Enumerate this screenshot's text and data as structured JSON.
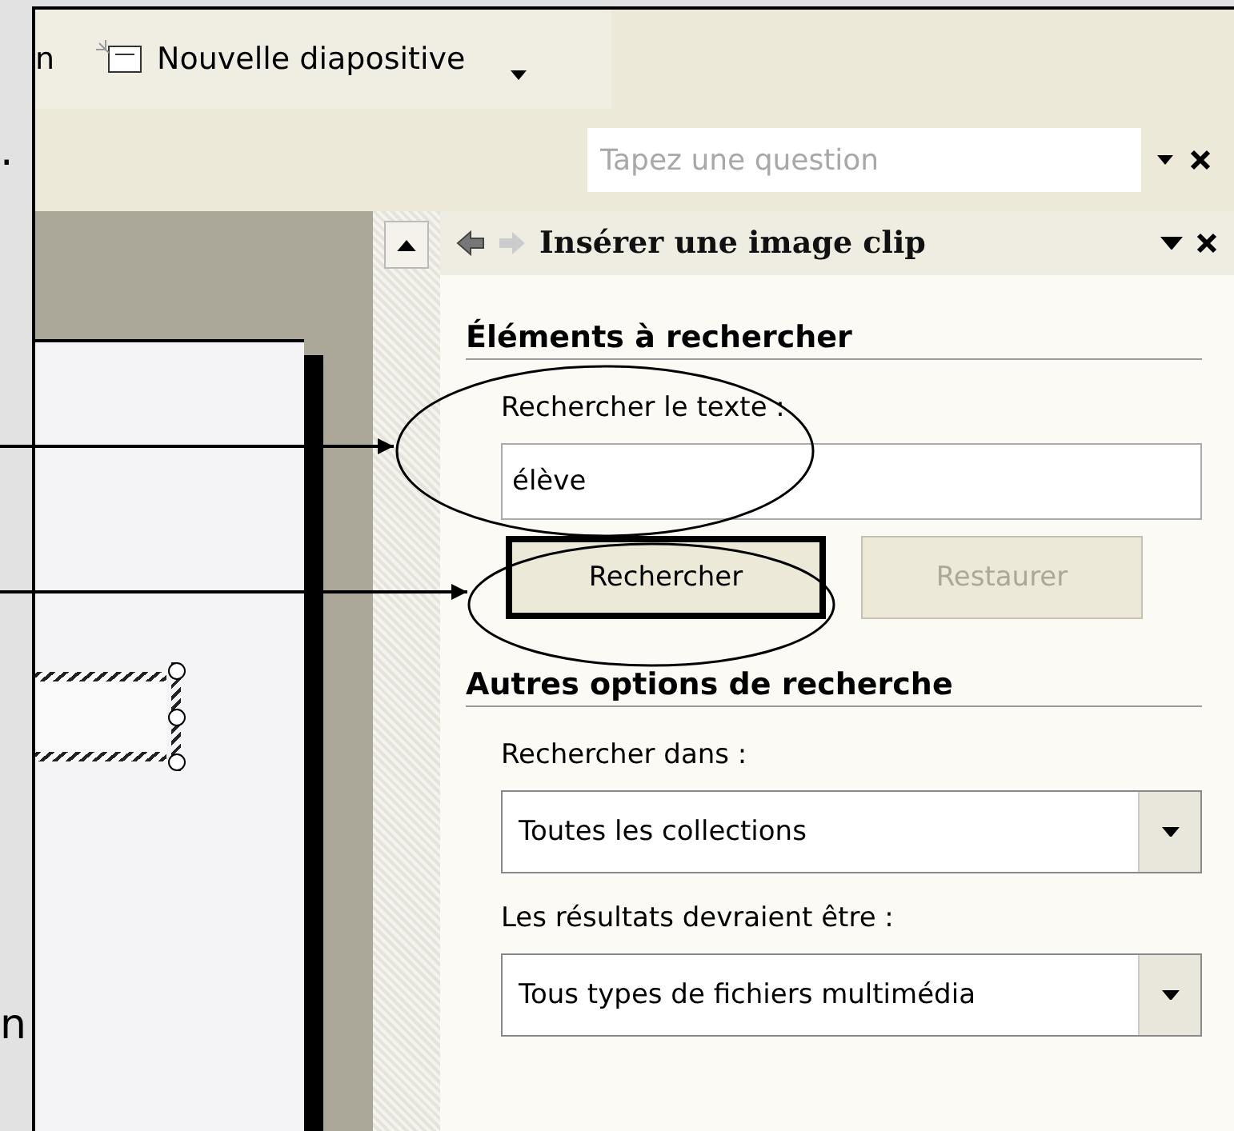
{
  "left_fragments": [
    ".",
    "n"
  ],
  "toolbar": {
    "cut_label": "n",
    "new_slide_label": "Nouvelle diapositive"
  },
  "help": {
    "placeholder": "Tapez une question"
  },
  "task_pane": {
    "title": "Insérer une image clip",
    "search_section": {
      "heading": "Éléments à rechercher",
      "label": "Rechercher le texte :",
      "value": "élève",
      "buttons": [
        {
          "label": "Rechercher",
          "default": true,
          "disabled": false
        },
        {
          "label": "Restaurer",
          "default": false,
          "disabled": true
        }
      ]
    },
    "options_section": {
      "heading": "Autres options de recherche",
      "fields": [
        {
          "label": "Rechercher dans :",
          "value": "Toutes les collections"
        },
        {
          "label": "Les résultats devraient être :",
          "value": "Tous types de fichiers multimédia"
        }
      ]
    }
  }
}
